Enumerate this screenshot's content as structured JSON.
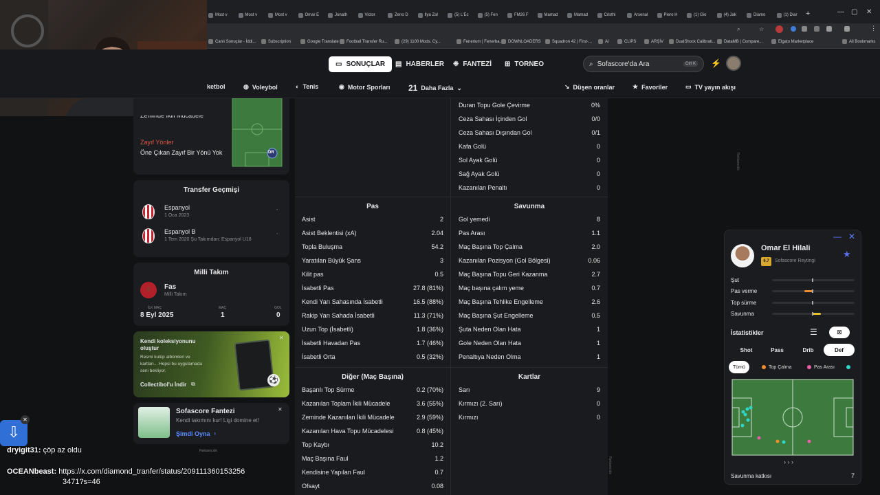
{
  "browser": {
    "tabs": [
      "Most v",
      "Most v",
      "Most v",
      "Omar E",
      "Jonath",
      "Victor",
      "Zeno D",
      "Ilya Zal",
      "(5) L'Ec",
      "(5) Fen",
      "FM26 F",
      "Mamad",
      "Mamad",
      "Cristhi",
      "Arsenal",
      "Piero H",
      "(1) Gio",
      "(4) Jak",
      "Diamo",
      "(1) Diar"
    ],
    "bookmarks": [
      "Canlı Sonuçlar - İddi...",
      "Subscription",
      "Google Translate",
      "Football Transfer Ru...",
      "(29) 1100 Mods. Cy...",
      "Fenerium | Fenerba...",
      "DOWNLOADERS",
      "Squadron 42 | First-...",
      "AI",
      "CLIPS",
      "ARŞİV",
      "DualShock Calibrati...",
      "DataMB | Compare...",
      "Elgato Marketplace",
      "All Bookmarks"
    ]
  },
  "topnav": {
    "items": [
      "SONUÇLAR",
      "HABERLER",
      "FANTEZİ",
      "TORNEO"
    ],
    "search_placeholder": "Sofascore'da Ara",
    "search_shortcut": "Ctrl K"
  },
  "sportnav": {
    "items": [
      "ketbol",
      "Voleybol",
      "Tenis",
      "Motor Sporları"
    ],
    "more_count": "21",
    "more_label": "Daha Fazla",
    "right": [
      "Düşen oranlar",
      "Favoriler",
      "TV yayın akışı"
    ]
  },
  "left": {
    "partial_label": "Zeminde İkili Mücadele",
    "weak_title": "Zayıf Yönler",
    "weak_text": "Öne Çıkan Zayıf Bir Yönü Yok",
    "position_badge": "DR",
    "transfer_title": "Transfer Geçmişi",
    "transfers": [
      {
        "club": "Espanyol",
        "date": "1 Oca 2023",
        "fee": "-"
      },
      {
        "club": "Espanyol B",
        "date": "1 Tem 2020 Şu Takımdan: Espanyol U18",
        "fee": "-"
      }
    ],
    "national_title": "Milli Takım",
    "national_team": "Fas",
    "national_sub": "Milli Takım",
    "debut_label": "İLK MAÇ",
    "debut_value": "8 Eyl 2025",
    "matches_label": "MAÇ",
    "matches_value": "1",
    "goals_label": "GOL",
    "goals_value": "0",
    "promo_title": "Kendi koleksiyonunu oluştur",
    "promo_text": "Resmi kulüp albümleri ve kartları... Hepsi bu uygulamada seni bekliyor.",
    "promo_link": "Collectibol'u İndir",
    "fantasy_title": "Sofascore Fantezi",
    "fantasy_text": "Kendi takımını kur! Ligi domine et!",
    "fantasy_link": "Şimdi Oyna",
    "ad_label": "Reklamcılık"
  },
  "stats": {
    "top_right": [
      [
        "Duran Topu Gole Çevirme",
        "0%"
      ],
      [
        "Ceza Sahası İçinden Gol",
        "0/0"
      ],
      [
        "Ceza Sahası Dışından Gol",
        "0/1"
      ],
      [
        "Kafa Golü",
        "0"
      ],
      [
        "Sol Ayak Golü",
        "0"
      ],
      [
        "Sağ Ayak Golü",
        "0"
      ],
      [
        "Kazanılan Penaltı",
        "0"
      ]
    ],
    "pas_title": "Pas",
    "pas": [
      [
        "Asist",
        "2"
      ],
      [
        "Asist Beklentisi (xA)",
        "2.04"
      ],
      [
        "Topla Buluşma",
        "54.2"
      ],
      [
        "Yaratılan Büyük Şans",
        "3"
      ],
      [
        "Kilit pas",
        "0.5"
      ],
      [
        "İsabetli Pas",
        "27.8 (81%)"
      ],
      [
        "Kendi Yarı Sahasında İsabetli",
        "16.5 (88%)"
      ],
      [
        "Rakip Yarı Sahada İsabetli",
        "11.3 (71%)"
      ],
      [
        "Uzun Top (İsabetli)",
        "1.8 (36%)"
      ],
      [
        "İsabetli Havadan Pas",
        "1.7 (46%)"
      ],
      [
        "İsabetli Orta",
        "0.5 (32%)"
      ]
    ],
    "savunma_title": "Savunma",
    "savunma": [
      [
        "Gol yemedi",
        "8"
      ],
      [
        "Pas Arası",
        "1.1"
      ],
      [
        "Maç Başına Top Çalma",
        "2.0"
      ],
      [
        "Kazanılan Pozisyon (Gol Bölgesi)",
        "0.06"
      ],
      [
        "Maç Başına Topu Geri Kazanma",
        "2.7"
      ],
      [
        "Maç başına çalım yeme",
        "0.7"
      ],
      [
        "Maç Başına Tehlike Engelleme",
        "2.6"
      ],
      [
        "Maç Başına Şut Engelleme",
        "0.5"
      ],
      [
        "Şuta Neden Olan Hata",
        "1"
      ],
      [
        "Gole Neden Olan Hata",
        "1"
      ],
      [
        "Penaltıya Neden Olma",
        "1"
      ]
    ],
    "diger_title": "Diğer (Maç Başına)",
    "diger": [
      [
        "Başarılı Top Sürme",
        "0.2 (70%)"
      ],
      [
        "Kazanılan Toplam İkili Mücadele",
        "3.6 (55%)"
      ],
      [
        "Zeminde Kazanılan İkili Mücadele",
        "2.9 (59%)"
      ],
      [
        "Kazanılan Hava Topu Mücadelesi",
        "0.8 (45%)"
      ],
      [
        "Top Kaybı",
        "10.2"
      ],
      [
        "Maç Başına Faul",
        "1.2"
      ],
      [
        "Kendisine Yapılan Faul",
        "0.7"
      ],
      [
        "Ofsayt",
        "0.08"
      ]
    ],
    "kartlar_title": "Kartlar",
    "kartlar": [
      [
        "Sarı",
        "9"
      ],
      [
        "Kırmızı (2. Sarı)",
        "0"
      ],
      [
        "Kırmızı",
        "0"
      ]
    ],
    "ad_label": "Reklamcılık"
  },
  "widget": {
    "player_name": "Omar El Hilali",
    "rating": "6.7",
    "rating_label": "Sofascore Reytingi",
    "attributes": [
      {
        "label": "Şut",
        "value": 0.0
      },
      {
        "label": "Pas verme",
        "value": -0.2
      },
      {
        "label": "Top sürme",
        "value": 0.0
      },
      {
        "label": "Savunma",
        "value": 0.2
      }
    ],
    "stats_label": "İstatistikler",
    "tabs": [
      "Shot",
      "Pass",
      "Drib",
      "Def"
    ],
    "active_tab": "Def",
    "chips": [
      "Tümü",
      "Top Çalma",
      "Pas Arası"
    ],
    "footer_label": "Savunma katkısı",
    "footer_value": "7",
    "colors": {
      "orange": "#f08c2e",
      "pink": "#e85ea8",
      "cyan": "#2fd6c8",
      "yellow": "#e5c229",
      "purple": "#5b6ef0"
    }
  },
  "chat": [
    {
      "user": "dryigit31:",
      "text": "çöp az oldu"
    },
    {
      "user": "OCEANbeast:",
      "text": "https://x.com/diamond_tranfer/status/209111360153256"
    },
    {
      "user": "",
      "text": "3471?s=46"
    }
  ]
}
